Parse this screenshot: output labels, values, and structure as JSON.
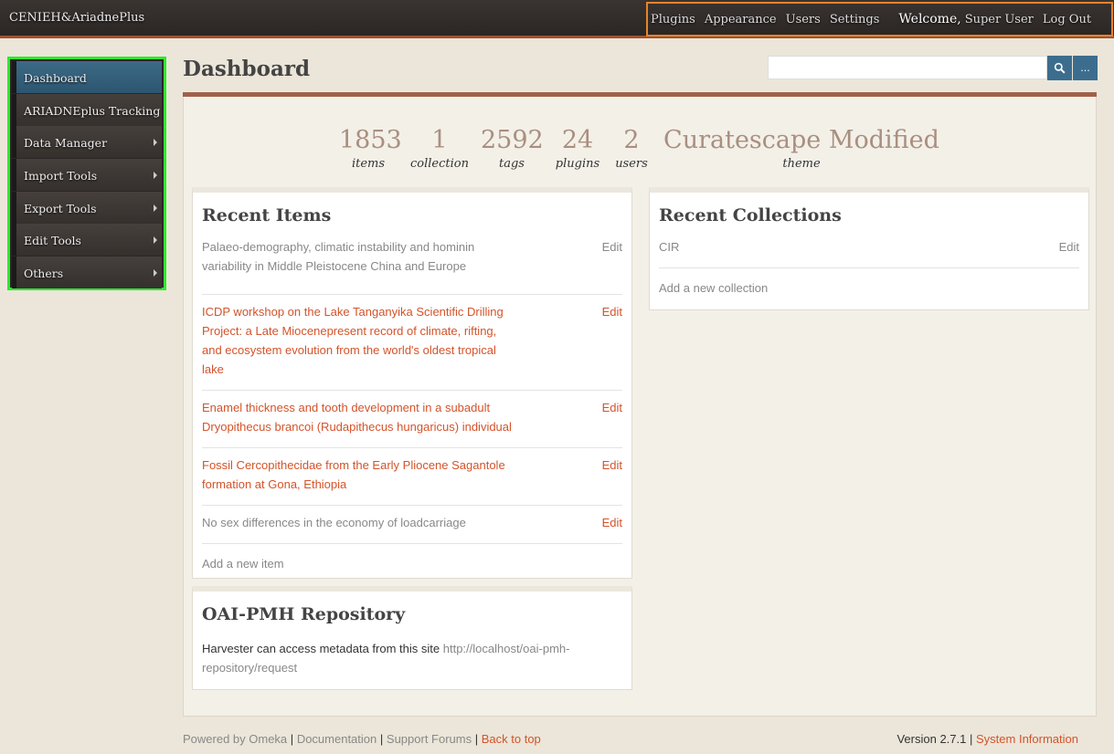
{
  "site": {
    "title": "CENIEH&AriadnePlus"
  },
  "topnav": {
    "plugins": "Plugins",
    "appearance": "Appearance",
    "users": "Users",
    "settings": "Settings",
    "welcome": "Welcome,",
    "username": "Super User",
    "logout": "Log Out"
  },
  "sidebar": {
    "items": [
      {
        "label": "Dashboard"
      },
      {
        "label": "ARIADNEplus Tracking"
      },
      {
        "label": "Data Manager"
      },
      {
        "label": "Import Tools"
      },
      {
        "label": "Export Tools"
      },
      {
        "label": "Edit Tools"
      },
      {
        "label": "Others"
      }
    ]
  },
  "page": {
    "title": "Dashboard"
  },
  "search": {
    "placeholder": "",
    "advanced": "..."
  },
  "stats": [
    {
      "value": "1853",
      "label": "items"
    },
    {
      "value": "1",
      "label": "collection"
    },
    {
      "value": "2592",
      "label": "tags"
    },
    {
      "value": "24",
      "label": "plugins"
    },
    {
      "value": "2",
      "users": "",
      "label": "users"
    },
    {
      "value": "Curatescape Modified",
      "label": "theme"
    }
  ],
  "recent_items": {
    "heading": "Recent Items",
    "edit_label": "Edit",
    "items": [
      {
        "title": "Palaeo-demography, climatic instability and hominin variability in Middle Pleistocene China and Europe"
      },
      {
        "title": "ICDP workshop on the Lake Tanganyika Scientific Drilling Project: a Late Miocenepresent record of climate, rifting, and ecosystem evolution from the world's oldest tropical lake"
      },
      {
        "title": "Enamel thickness and tooth development in a subadult Dryopithecus brancoi (Rudapithecus hungaricus) individual"
      },
      {
        "title": "Fossil Cercopithecidae from the Early Pliocene Sagantole formation at Gona, Ethiopia"
      },
      {
        "title": "No sex differences in the economy of loadcarriage"
      }
    ],
    "add_link": "Add a new item"
  },
  "recent_collections": {
    "heading": "Recent Collections",
    "edit_label": "Edit",
    "items": [
      {
        "title": "CIR"
      }
    ],
    "add_link": "Add a new collection"
  },
  "oai": {
    "heading": "OAI-PMH Repository",
    "text": "Harvester can access metadata from this site",
    "url_part1": "http://localhost/oai-pmh-",
    "url_part2": "repository/request"
  },
  "footer": {
    "powered": "Powered by Omeka",
    "documentation": "Documentation",
    "forums": "Support Forums",
    "back_to_top": "Back to top",
    "sep": "|",
    "version": "Version 2.7.1",
    "system_info": "System Information"
  },
  "colors": {
    "accent": "#d4532a",
    "nav_highlight": "#e8832e",
    "sidebar_outline": "#2ee82e",
    "search_button": "#3d6d8e"
  }
}
